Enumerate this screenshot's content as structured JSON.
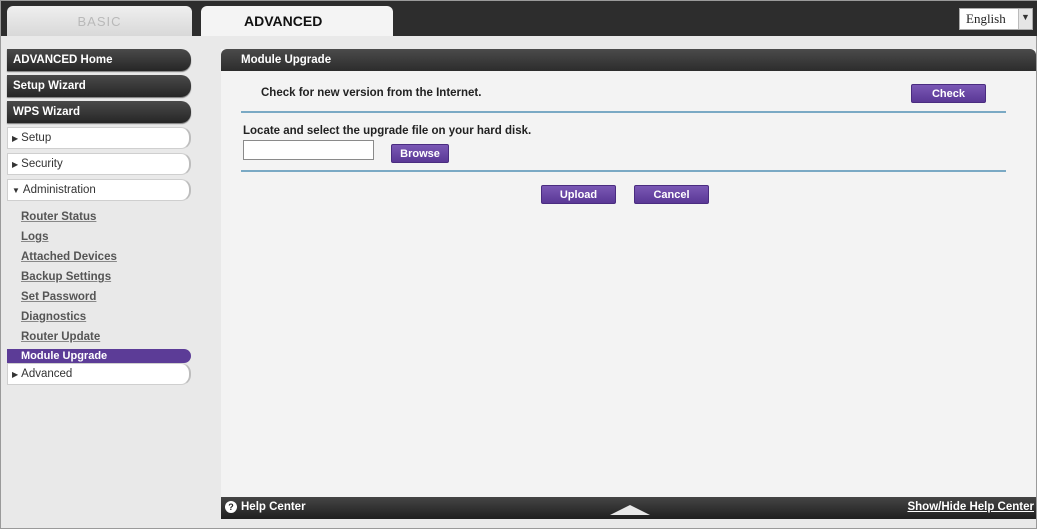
{
  "top_tabs": {
    "basic": "BASIC",
    "advanced": "ADVANCED"
  },
  "language": {
    "selected": "English"
  },
  "sidebar": {
    "dark_items": [
      "ADVANCED Home",
      "Setup Wizard",
      "WPS Wizard"
    ],
    "sections": [
      "Setup",
      "Security",
      "Administration",
      "Advanced"
    ],
    "admin_items": [
      "Router Status",
      "Logs",
      "Attached Devices",
      "Backup Settings",
      "Set Password",
      "Diagnostics",
      "Router Update",
      "Module Upgrade"
    ]
  },
  "main": {
    "title": "Module Upgrade",
    "check_text": "Check for new version from the Internet.",
    "check_button": "Check",
    "locate_text": "Locate and select the upgrade file on your hard disk.",
    "file_value": "",
    "browse_button": "Browse",
    "upload_button": "Upload",
    "cancel_button": "Cancel"
  },
  "helpbar": {
    "help_center": "Help Center",
    "toggle": "Show/Hide Help Center"
  },
  "colors": {
    "accent_purple": "#5c3c97",
    "dark_bar": "#2d2d2d",
    "divider_blue": "#7aa9c4"
  }
}
